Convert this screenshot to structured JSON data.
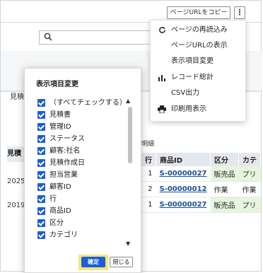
{
  "toolbar": {
    "copy_url_label": "ページURLをコピー",
    "kebab_label": "⋮"
  },
  "menu": {
    "items": [
      {
        "label": "ページの再読込み",
        "icon": "refresh-icon"
      },
      {
        "label": "ページURLの表示",
        "icon": ""
      },
      {
        "label": "表示項目変更",
        "icon": ""
      },
      {
        "label": "レコード総計",
        "icon": "bar-chart-icon"
      },
      {
        "label": "CSV出力",
        "icon": ""
      },
      {
        "label": "印刷用表示",
        "icon": "printer-icon"
      }
    ]
  },
  "panel": {
    "title": "表示項目変更",
    "items": [
      {
        "label": "（すべてチェックする）",
        "checked": true
      },
      {
        "label": "見積書",
        "checked": true
      },
      {
        "label": "管理ID",
        "checked": true
      },
      {
        "label": "ステータス",
        "checked": true
      },
      {
        "label": "顧客:社名",
        "checked": true
      },
      {
        "label": "見積作成日",
        "checked": true
      },
      {
        "label": "担当営業",
        "checked": true
      },
      {
        "label": "顧客ID",
        "checked": true
      },
      {
        "label": "行",
        "checked": true
      },
      {
        "label": "商品ID",
        "checked": true
      },
      {
        "label": "区分",
        "checked": true
      },
      {
        "label": "カテゴリ",
        "checked": true
      }
    ],
    "confirm_label": "確定",
    "close_label": "閉じる"
  },
  "background": {
    "tab_label": "見積",
    "left_header": "見積作",
    "left_rows": [
      "2025/",
      "2019/"
    ],
    "detail_label": "明細",
    "table": {
      "headers": [
        "行",
        "商品ID",
        "区分",
        "カテ"
      ],
      "rows": [
        {
          "cells": [
            "1",
            "S-00000027",
            "販売品",
            "プリ"
          ]
        },
        {
          "cells": [
            "2",
            "S-00000012",
            "作業",
            "作業"
          ]
        },
        {
          "cells": [
            "1",
            "S-00000027",
            "販売品",
            "プリ"
          ]
        }
      ]
    }
  }
}
